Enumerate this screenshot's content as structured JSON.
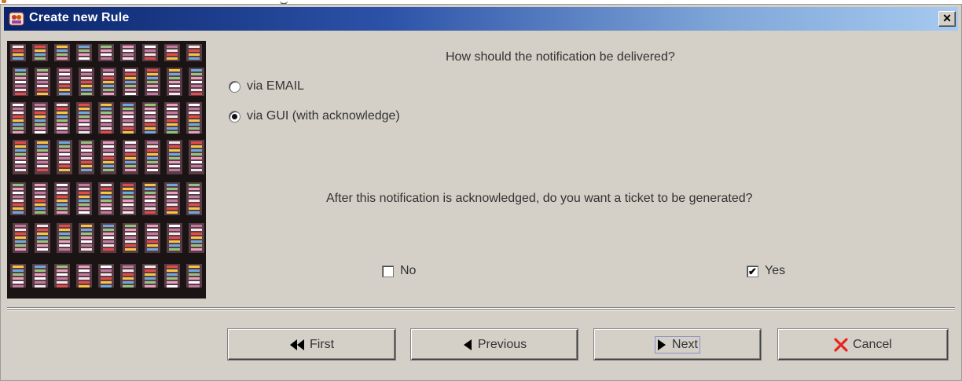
{
  "window": {
    "title": "Create new Rule",
    "close_label": "✕"
  },
  "delivery": {
    "question": "How should the notification be delivered?",
    "options": [
      {
        "label": "via EMAIL",
        "selected": false
      },
      {
        "label": "via GUI (with acknowledge)",
        "selected": true
      }
    ]
  },
  "ticket": {
    "question": "After this notification is acknowledged, do you want a ticket to be generated?",
    "no_label": "No",
    "no_checked": false,
    "yes_label": "Yes",
    "yes_checked": true,
    "check_mark": "✔"
  },
  "buttons": {
    "first": "First",
    "previous": "Previous",
    "next": "Next",
    "cancel": "Cancel"
  },
  "icons": {
    "title": "app-icon",
    "first": "double-left-arrow-icon",
    "previous": "left-triangle-icon",
    "next": "right-triangle-icon",
    "cancel": "red-x-icon"
  },
  "colors": {
    "title_bar_start": "#0a246a",
    "title_bar_end": "#a6caf0",
    "dialog_bg": "#d4d0c8",
    "cancel_icon": "#e8241c"
  }
}
